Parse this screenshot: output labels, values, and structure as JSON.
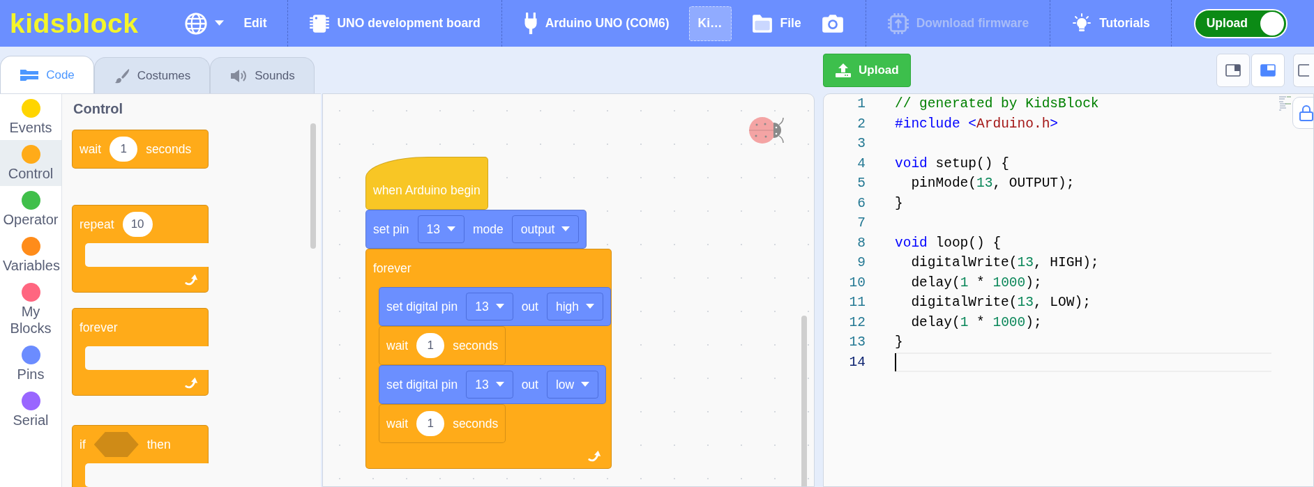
{
  "header": {
    "logo": "kidsblock",
    "menu_groups": [
      [
        {
          "kind": "language"
        },
        {
          "kind": "plain",
          "label": "Edit"
        }
      ],
      [
        {
          "kind": "board",
          "label": "UNO development board"
        }
      ],
      [
        {
          "kind": "port",
          "label": "Arduino UNO (COM6)"
        },
        {
          "kind": "project",
          "label": "Ki…"
        },
        {
          "kind": "file",
          "label": "File"
        },
        {
          "kind": "camera"
        }
      ],
      [
        {
          "kind": "firmware",
          "label": "Download firmware",
          "disabled": true
        }
      ],
      [
        {
          "kind": "tutorials",
          "label": "Tutorials"
        }
      ]
    ],
    "mode_toggle": {
      "label": "Upload",
      "on": true
    }
  },
  "tabs": [
    {
      "kind": "code",
      "label": "Code",
      "selected": true
    },
    {
      "kind": "costumes",
      "label": "Costumes",
      "selected": false
    },
    {
      "kind": "sounds",
      "label": "Sounds",
      "selected": false
    }
  ],
  "categories": [
    {
      "label": "Events",
      "color": "#ffd500",
      "selected": false
    },
    {
      "label": "Control",
      "color": "#ffab19",
      "selected": true
    },
    {
      "label": "Operator",
      "color": "#40bf4a",
      "selected": false
    },
    {
      "label": "Variables",
      "color": "#ff8c1a",
      "selected": false
    },
    {
      "label": "My Blocks",
      "color": "#ff6680",
      "selected": false
    },
    {
      "label": "Pins",
      "color": "#6b8cff",
      "selected": false
    },
    {
      "label": "Serial",
      "color": "#9966ff",
      "selected": false
    }
  ],
  "palette": {
    "title": "Control",
    "blocks": [
      {
        "kind": "stack",
        "color": "#ffab19",
        "parts": [
          {
            "kind": "text",
            "text": "wait"
          },
          {
            "kind": "number",
            "text": "1"
          },
          {
            "kind": "text",
            "text": "seconds"
          }
        ]
      },
      {
        "kind": "loop",
        "color": "#ffab19",
        "parts": [
          {
            "kind": "text",
            "text": "repeat"
          },
          {
            "kind": "number",
            "text": "10"
          }
        ]
      },
      {
        "kind": "loop",
        "color": "#ffab19",
        "parts": [
          {
            "kind": "text",
            "text": "forever"
          }
        ]
      },
      {
        "kind": "if",
        "color": "#ffab19",
        "parts": [
          {
            "kind": "text",
            "text": "if"
          },
          {
            "kind": "boolean"
          },
          {
            "kind": "text",
            "text": "then"
          }
        ]
      }
    ]
  },
  "script": [
    {
      "kind": "hat",
      "color": "#f8c625",
      "parts": [
        {
          "kind": "text",
          "text": "when Arduino begin"
        }
      ]
    },
    {
      "kind": "stack",
      "color": "#6b8fff",
      "parts": [
        {
          "kind": "text",
          "text": "set pin"
        },
        {
          "kind": "dropdown",
          "text": "13"
        },
        {
          "kind": "text",
          "text": "mode"
        },
        {
          "kind": "dropdown",
          "text": "output"
        }
      ]
    },
    {
      "kind": "loop",
      "color": "#ffab19",
      "parts": [
        {
          "kind": "text",
          "text": "forever"
        }
      ],
      "children": [
        {
          "kind": "stack",
          "color": "#6b8fff",
          "parts": [
            {
              "kind": "text",
              "text": "set digital pin"
            },
            {
              "kind": "dropdown",
              "text": "13"
            },
            {
              "kind": "text",
              "text": "out"
            },
            {
              "kind": "menu",
              "text": "high"
            }
          ]
        },
        {
          "kind": "stack",
          "color": "#ffab19",
          "parts": [
            {
              "kind": "text",
              "text": "wait"
            },
            {
              "kind": "number",
              "text": "1"
            },
            {
              "kind": "text",
              "text": "seconds"
            }
          ]
        },
        {
          "kind": "stack",
          "color": "#6b8fff",
          "parts": [
            {
              "kind": "text",
              "text": "set digital pin"
            },
            {
              "kind": "dropdown",
              "text": "13"
            },
            {
              "kind": "text",
              "text": "out"
            },
            {
              "kind": "menu",
              "text": "low"
            }
          ]
        },
        {
          "kind": "stack",
          "color": "#ffab19",
          "parts": [
            {
              "kind": "text",
              "text": "wait"
            },
            {
              "kind": "number",
              "text": "1"
            },
            {
              "kind": "text",
              "text": "seconds"
            }
          ]
        }
      ]
    }
  ],
  "toolbar": {
    "upload_button": {
      "label": "Upload"
    },
    "layout_buttons": [
      {
        "selected": false
      },
      {
        "selected": true
      },
      {
        "selected": false
      }
    ]
  },
  "code": {
    "lines": [
      {
        "number": "1",
        "current": false,
        "tokens": [
          {
            "kind": "comment",
            "text": "// generated by KidsBlock"
          }
        ]
      },
      {
        "number": "2",
        "current": false,
        "tokens": [
          {
            "kind": "keyword",
            "text": "#include <"
          },
          {
            "kind": "string",
            "text": "Arduino.h"
          },
          {
            "kind": "keyword",
            "text": ">"
          }
        ]
      },
      {
        "number": "3",
        "current": false
      },
      {
        "number": "4",
        "current": false,
        "tokens": [
          {
            "kind": "keyword",
            "text": "void"
          },
          {
            "kind": "plain",
            "text": " setup() {"
          }
        ]
      },
      {
        "number": "5",
        "current": false,
        "tokens": [
          {
            "kind": "plain",
            "text": "  pinMode("
          },
          {
            "kind": "number",
            "text": "13"
          },
          {
            "kind": "plain",
            "text": ", OUTPUT);"
          }
        ]
      },
      {
        "number": "6",
        "current": false,
        "tokens": [
          {
            "kind": "plain",
            "text": "}"
          }
        ]
      },
      {
        "number": "7",
        "current": false
      },
      {
        "number": "8",
        "current": false,
        "tokens": [
          {
            "kind": "keyword",
            "text": "void"
          },
          {
            "kind": "plain",
            "text": " loop() {"
          }
        ]
      },
      {
        "number": "9",
        "current": false,
        "tokens": [
          {
            "kind": "plain",
            "text": "  digitalWrite("
          },
          {
            "kind": "number",
            "text": "13"
          },
          {
            "kind": "plain",
            "text": ", HIGH);"
          }
        ]
      },
      {
        "number": "10",
        "current": false,
        "tokens": [
          {
            "kind": "plain",
            "text": "  delay("
          },
          {
            "kind": "number",
            "text": "1"
          },
          {
            "kind": "plain",
            "text": " * "
          },
          {
            "kind": "number",
            "text": "1000"
          },
          {
            "kind": "plain",
            "text": ");"
          }
        ]
      },
      {
        "number": "11",
        "current": false,
        "tokens": [
          {
            "kind": "plain",
            "text": "  digitalWrite("
          },
          {
            "kind": "number",
            "text": "13"
          },
          {
            "kind": "plain",
            "text": ", LOW);"
          }
        ]
      },
      {
        "number": "12",
        "current": false,
        "tokens": [
          {
            "kind": "plain",
            "text": "  delay("
          },
          {
            "kind": "number",
            "text": "1"
          },
          {
            "kind": "plain",
            "text": " * "
          },
          {
            "kind": "number",
            "text": "1000"
          },
          {
            "kind": "plain",
            "text": ");"
          }
        ]
      },
      {
        "number": "13",
        "current": false,
        "tokens": [
          {
            "kind": "plain",
            "text": "}"
          }
        ]
      },
      {
        "number": "14",
        "current": true
      }
    ]
  }
}
